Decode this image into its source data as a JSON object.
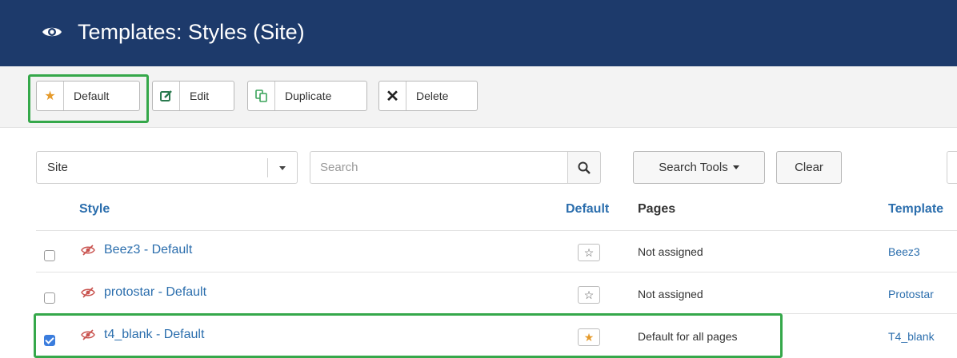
{
  "header": {
    "title": "Templates: Styles (Site)",
    "icon": "eye-icon"
  },
  "toolbar": {
    "default_label": "Default",
    "edit_label": "Edit",
    "duplicate_label": "Duplicate",
    "delete_label": "Delete"
  },
  "filters": {
    "client_select": "Site",
    "search_placeholder": "Search",
    "search_tools_label": "Search Tools",
    "clear_label": "Clear"
  },
  "table": {
    "columns": {
      "style": "Style",
      "default": "Default",
      "pages": "Pages",
      "template": "Template"
    },
    "rows": [
      {
        "style": "Beez3 - Default",
        "checked": false,
        "is_default": false,
        "pages": "Not assigned",
        "template": "Beez3"
      },
      {
        "style": "protostar - Default",
        "checked": false,
        "is_default": false,
        "pages": "Not assigned",
        "template": "Protostar"
      },
      {
        "style": "t4_blank - Default",
        "checked": true,
        "is_default": true,
        "pages": "Default for all pages",
        "template": "T4_blank"
      }
    ]
  },
  "colors": {
    "header_bg": "#1d3a6b",
    "link": "#2b6ead",
    "star_orange": "#e59a2b",
    "highlight_green": "#35a84a",
    "checkbox_blue": "#3b7ddd"
  }
}
